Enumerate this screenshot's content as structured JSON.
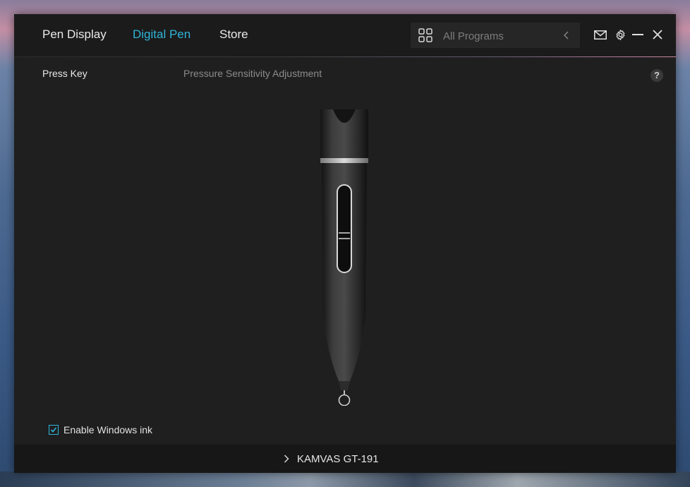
{
  "nav": {
    "tabs": [
      {
        "label": "Pen Display",
        "active": false
      },
      {
        "label": "Digital Pen",
        "active": true
      },
      {
        "label": "Store",
        "active": false
      }
    ]
  },
  "search": {
    "placeholder": "All Programs",
    "icon": "grid-icon"
  },
  "toolbar": {
    "icons": [
      "mail-icon",
      "gear-icon",
      "minimize-icon",
      "close-icon"
    ]
  },
  "subtabs": [
    {
      "label": "Press Key",
      "active": true
    },
    {
      "label": "Pressure Sensitivity Adjustment",
      "active": false
    }
  ],
  "help": {
    "label": "?"
  },
  "windows_ink": {
    "label": "Enable Windows ink",
    "checked": true
  },
  "device": {
    "label": "KAMVAS GT-191"
  },
  "colors": {
    "accent": "#2fb4d8",
    "background": "#1f1f1f",
    "topbar": "#1b1b1b"
  }
}
